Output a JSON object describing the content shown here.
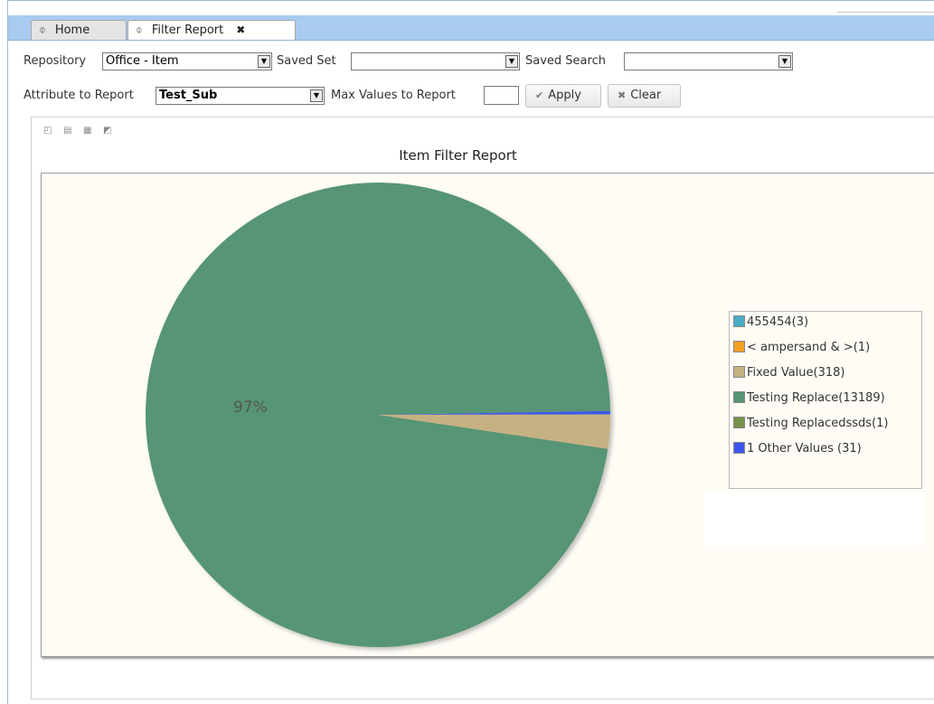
{
  "tabs": [
    {
      "label": "Home",
      "icon": "refresh-icon"
    },
    {
      "label": "Filter Report",
      "icon": "refresh-icon",
      "close": "✖"
    }
  ],
  "filters": {
    "repository_label": "Repository",
    "repository_value": "Office - Item",
    "saved_set_label": "Saved Set",
    "saved_set_value": "",
    "saved_search_label": "Saved Search",
    "saved_search_value": "",
    "attribute_label": "Attribute to Report",
    "attribute_value": "Test_Sub",
    "max_values_label": "Max Values to Report",
    "max_values_value": "",
    "apply_label": "Apply",
    "clear_label": "Clear"
  },
  "chart_data": {
    "type": "pie",
    "title": "Item Filter Report",
    "slices": [
      {
        "label": "455454(3)",
        "value": 3,
        "color": "#4bacc6"
      },
      {
        "label": "< ampersand & >(1)",
        "value": 1,
        "color": "#f4a124"
      },
      {
        "label": "Fixed Value(318)",
        "value": 318,
        "color": "#c6b182"
      },
      {
        "label": "Testing Replace(13189)",
        "value": 13189,
        "color": "#579575"
      },
      {
        "label": "Testing Replacedssds(1)",
        "value": 1,
        "color": "#77924a"
      },
      {
        "label": "1 Other Values (31)",
        "value": 31,
        "color": "#3a56ef"
      }
    ],
    "data_labels": [
      "97%"
    ],
    "legend_placement": "right"
  }
}
